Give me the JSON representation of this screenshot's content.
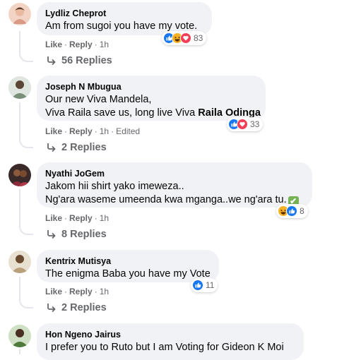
{
  "labels": {
    "like": "Like",
    "reply": "Reply",
    "dot": "·"
  },
  "comments": [
    {
      "author": "Lydliz Cheprot",
      "lines": [
        "Am from sugoi you have my vote."
      ],
      "time": "1h",
      "edited": "",
      "reactions": [
        "like-icon",
        "haha-icon",
        "love-icon"
      ],
      "reaction_count": "83",
      "replies": "56 Replies",
      "avatar_color": "#e9b9a0"
    },
    {
      "author": "Joseph N Mbugua",
      "lines": [
        "Our new Viva Mandela,",
        "Viva Raila save us, long live Viva "
      ],
      "mention": "Raila Odinga",
      "time": "1h",
      "edited": "Edited",
      "reactions": [
        "like-icon",
        "love-icon"
      ],
      "reaction_count": "33",
      "replies": "2 Replies",
      "avatar_color": "#7a8f7a"
    },
    {
      "author": "Nyathi JoGem",
      "lines": [
        "Jakom hii shirt yako imeweza..",
        "Ng'ara waseme umeenda kwa mganga..we ng'ara tu."
      ],
      "check": "✔",
      "time": "1h",
      "edited": "",
      "reactions": [
        "haha-icon",
        "like-icon"
      ],
      "reaction_count": "8",
      "replies": "8 Replies",
      "avatar_color": "#8b2c3a"
    },
    {
      "author": "Kentrix Mutisya",
      "lines": [
        "The enigma Baba you have my Vote"
      ],
      "time": "1h",
      "edited": "",
      "reactions": [
        "like-icon"
      ],
      "reaction_count": "11",
      "replies": "2 Replies",
      "avatar_color": "#b9a27a"
    },
    {
      "author": "Hon Ngeno Jairus",
      "lines": [
        "I prefer you to Ruto but I am Voting for Gideon K Moi"
      ],
      "time": "",
      "edited": "",
      "reactions": [],
      "reaction_count": "",
      "replies": "",
      "avatar_color": "#4e7a3a"
    }
  ],
  "colors": {
    "like": "#1877f2",
    "love": "#f33e58",
    "haha": "#f7b125"
  }
}
